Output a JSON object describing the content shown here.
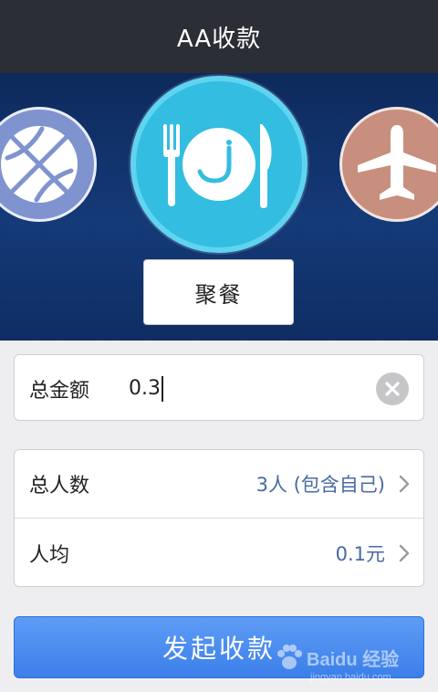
{
  "header": {
    "title": "AA收款"
  },
  "categories": {
    "left_icon": "basketball-icon",
    "center_icon": "dining-icon",
    "right_icon": "airplane-icon",
    "selected_label": "聚餐"
  },
  "amount": {
    "label": "总金额",
    "value": "0.3",
    "clear_icon": "clear-icon"
  },
  "info": {
    "people_label": "总人数",
    "people_value": "3人 (包含自己)",
    "per_person_label": "人均",
    "per_person_value": "0.1元"
  },
  "submit": {
    "label": "发起收款"
  },
  "watermark": {
    "text": "Baidu 经验",
    "url": "jingyan.baidu.com"
  },
  "colors": {
    "accent": "#3b7fea",
    "banner": "#143a78",
    "center_circle": "#33bde0",
    "value_text": "#4a6aa0"
  }
}
